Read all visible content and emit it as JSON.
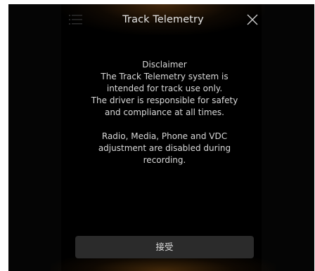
{
  "header": {
    "title": "Track Telemetry",
    "menu_icon": "hamburger-menu-icon",
    "close_icon": "close-icon"
  },
  "message": {
    "heading": "Disclaimer",
    "line1": "The Track Telemetry system is",
    "line2": "intended for track use only.",
    "line3": "The driver is responsible for safety",
    "line4": "and compliance at all times.",
    "line5": "Radio, Media, Phone and VDC",
    "line6": "adjustment are disabled during",
    "line7": "recording."
  },
  "footer": {
    "accept_label": "接受"
  },
  "colors": {
    "panel_background": "#000000",
    "text": "#d9d9d9",
    "button_background": "#2b2b2b",
    "glow": "#965a14"
  }
}
